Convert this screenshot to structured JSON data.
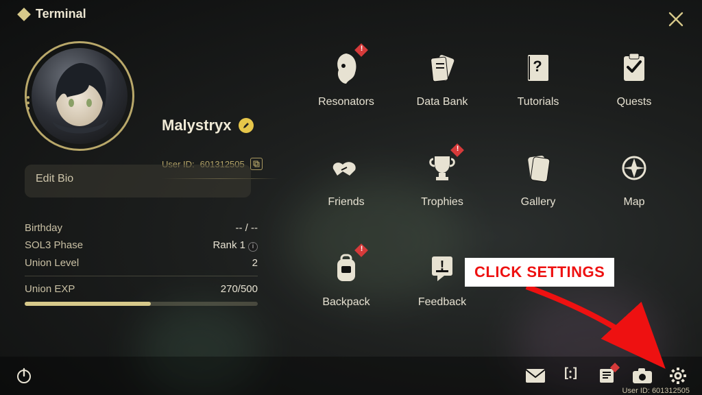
{
  "header": {
    "title": "Terminal"
  },
  "profile": {
    "name": "Malystryx",
    "user_id_label": "User ID:",
    "user_id": "601312505",
    "bio_placeholder": "Edit Bio"
  },
  "stats": {
    "birthday_label": "Birthday",
    "birthday_value": "-- / --",
    "phase_label": "SOL3 Phase",
    "phase_value": "Rank 1",
    "level_label": "Union Level",
    "level_value": "2",
    "exp_label": "Union EXP",
    "exp_current": 270,
    "exp_max": 500
  },
  "menu": [
    {
      "key": "resonators",
      "label": "Resonators",
      "alert": true
    },
    {
      "key": "databank",
      "label": "Data Bank",
      "alert": false
    },
    {
      "key": "tutorials",
      "label": "Tutorials",
      "alert": false
    },
    {
      "key": "quests",
      "label": "Quests",
      "alert": false
    },
    {
      "key": "friends",
      "label": "Friends",
      "alert": false
    },
    {
      "key": "trophies",
      "label": "Trophies",
      "alert": true
    },
    {
      "key": "gallery",
      "label": "Gallery",
      "alert": false
    },
    {
      "key": "map",
      "label": "Map",
      "alert": false
    },
    {
      "key": "backpack",
      "label": "Backpack",
      "alert": true
    },
    {
      "key": "feedback",
      "label": "Feedback",
      "alert": false
    }
  ],
  "bottom": {
    "mail_alert": false,
    "notice_alert": true,
    "user_id_footer": "User ID: 601312505"
  },
  "annotation": {
    "text": "CLICK SETTINGS"
  },
  "colors": {
    "accent": "#d7c98a",
    "alert": "#d63a3a",
    "text": "#e7e2d2"
  }
}
